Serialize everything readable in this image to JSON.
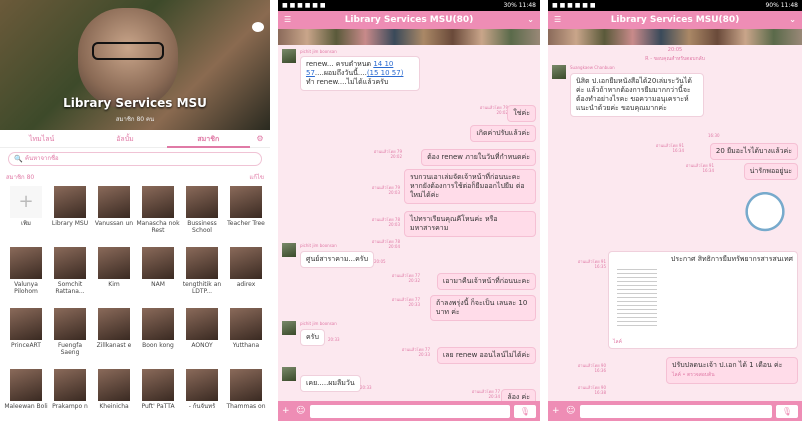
{
  "p1": {
    "title": "Library Services MSU",
    "sub": "สมาชิก 80 คน",
    "tabs": [
      "ไทมไลน์",
      "อัลบั้ม",
      "สมาชิก"
    ],
    "search_placeholder": "ค้นหาจากชื่อ",
    "members_label": "สมาชิก 80",
    "edit_label": "แก้ไข",
    "members": [
      "เพิ่ม",
      "Library MSU",
      "Vanussan un",
      "Manascha nok Rest",
      "Bussiness School",
      "Teacher Tree",
      "Valunya Pilohom",
      "Somchit Rattana...",
      "Kim",
      "NAM",
      "tengthitik an LDTP...",
      "adirex",
      "PrinceART",
      "Fuengfa Saeng",
      "Zillkanast e",
      "Boon kong",
      "AONOY",
      "Yutthana",
      "Maleewan Boli",
      "Prakampo n",
      "Kheinicha",
      "Puft' PaTTA",
      "- ก้นจันทร์",
      "Thammas on"
    ]
  },
  "p2": {
    "status_time": "11:48",
    "status_batt": "30%",
    "chat_title": "Library Services MSU(80)",
    "sender1": "pichit jim boonsan",
    "m1": "renew... ครบตำหนด",
    "m1_link1": "14 10 57",
    "m1b": "....ผอมถึงวันนี้....",
    "m1_link2": "(15 10 57)",
    "m1c": "ทำ renew....ไม่ได้แล้วครับ",
    "r1": "อ่านแล้วโดย 79",
    "t1": "20:02",
    "o1": "ใช่ค่ะ",
    "o2": "เกิดค่าปรับแล้วค่ะ",
    "r2": "อ่านแล้วโดย 79",
    "t2": "20:02",
    "o3": "ต้อง renew ภายในวันที่กำหนดค่ะ",
    "r3": "อ่านแล้วโดย 79",
    "t3": "20:03",
    "o4": "รบกวนเอาเล่มจัดเจ้าหน้าที่ก่อนนะคะ หากยังต้องการใช้ต่อก็ยืมออกไปยืม ต่อใหม่ได้ค่ะ",
    "r4": "อ่านแล้วโดย 78",
    "t4": "20:03",
    "o5": "ไปทราเรียนคุณคีโหนค่ะ หรือ มหาสารคาม",
    "r5": "อ่านแล้วโดย 78",
    "t5": "20:04",
    "sender2": "pichit jim boonsan",
    "m2": "ศูนย์สาราคาม...ครับ",
    "tm2": "20:05",
    "r6": "อ่านแล้วโดย 77",
    "t6": "20:32",
    "o6": "เอามาคืนเจ้าหน้าที่ก่อนนะคะ",
    "r7": "อ่านแล้วโดย 77",
    "t7": "20:33",
    "o7": "ถ้าลงพรุ่งนี้ ก็จะเป็น เลนละ 10 บาท ค่ะ",
    "m3": "ครับ",
    "tm3": "20:33",
    "r8": "อ่านแล้วโดย 77",
    "t8": "20:33",
    "o8": "เลย renew ออนไลน์ไม่ได้ค่ะ",
    "m4": "เคย.....ผมลืมวัน",
    "tm4": "20:33",
    "r9": "อ่านแล้วโดย 77",
    "t9": "20:34",
    "o9": "ล้อง ค่ะ"
  },
  "p3": {
    "status_time": "11:48",
    "status_batt": "90%",
    "chat_title": "Library Services MSU(80)",
    "date_line": "20:05",
    "note_line": "R - ขอบคุณสำหรับตอบกลับ",
    "sender1": "Suangkaew Chanbuan",
    "m1": "นิสิต ป.เอกยืมหนังสือได้20เล่มระวันได้ค่ะ แล้วถ้าหากต้องการยืมมากกว่านี้จะ ต้องทำอย่างไรคะ ขอความอนุเคราะห์แนะนำด้วยค่ะ ขอบคุณมากค่ะ",
    "tm1": "16:30",
    "r1": "อ่านแล้วโดย 91",
    "t1": "16:34",
    "o1": "20 ยืมอะไรได้บางแล้วค่ะ",
    "r2": "อ่านแล้วโดย 91",
    "t2": "16:34",
    "o2": "น่ารักพออยู่นะ",
    "r3": "อ่านแล้วโดย 91",
    "t3": "16:35",
    "o3": "ประกาศ สิทธิการยืมทรัพยากรสารสนเทศ",
    "r4": "อ่านแล้วโดย 90",
    "t4": "16:36",
    "link1": "ไลค์",
    "o4": "ปรับปลดนะเจ้า ป.เอก ได้ 1 เดือน ค่ะ",
    "r5": "อ่านแล้วโดย 90",
    "t5": "16:38",
    "link2": "ไลค์ • ตรวจสอบต้น"
  }
}
